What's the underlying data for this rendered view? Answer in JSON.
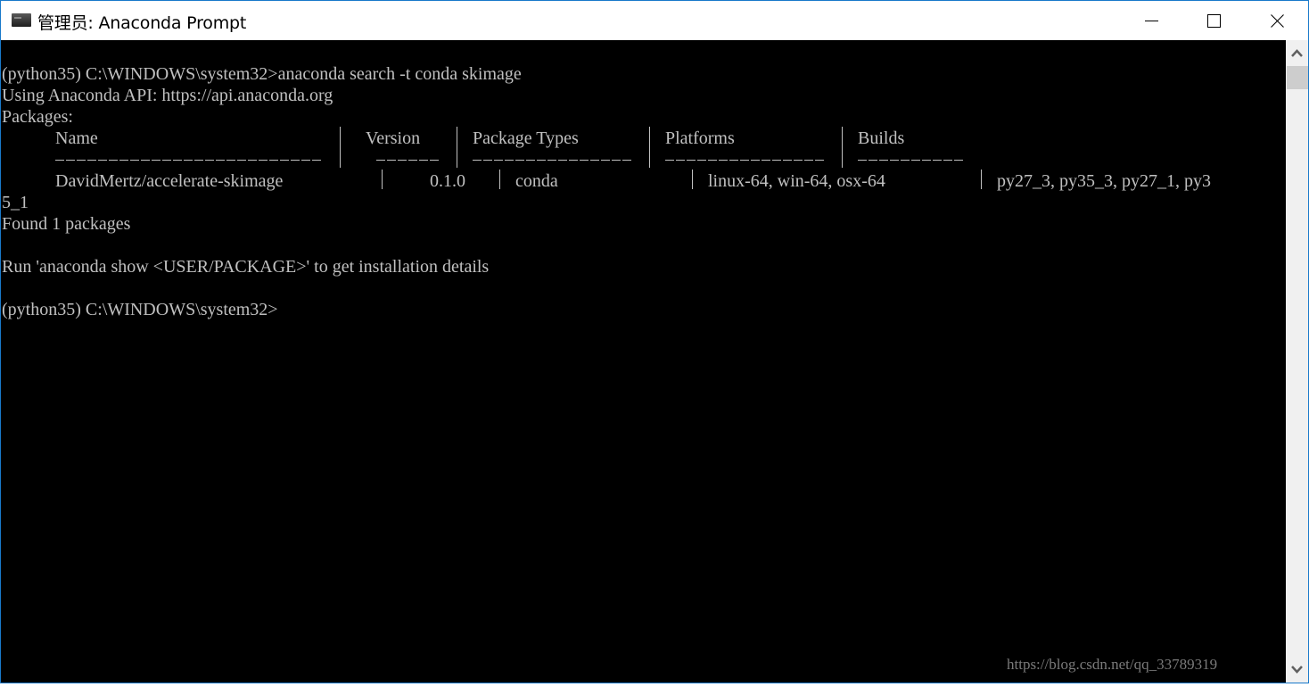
{
  "window": {
    "title": "管理员: Anaconda Prompt",
    "controls": {
      "minimize": "minimize",
      "maximize": "maximize",
      "close": "close"
    }
  },
  "console": {
    "lines": [
      "(python35) C:\\WINDOWS\\system32>anaconda search -t conda skimage",
      "Using Anaconda API: https://api.anaconda.org",
      "Packages:",
      "5_1",
      "Found 1 packages",
      "",
      "Run 'anaconda show <USER/PACKAGE>' to get installation details",
      "",
      "(python35) C:\\WINDOWS\\system32>"
    ],
    "table": {
      "headers": [
        "Name",
        "Version",
        "Package Types",
        "Platforms",
        "Builds"
      ],
      "rows": [
        [
          "DavidMertz/accelerate-skimage",
          "0.1.0",
          "conda",
          "linux-64, win-64, osx-64",
          "py27_3, py35_3, py27_1, py3"
        ]
      ]
    }
  },
  "watermark": "https://blog.csdn.net/qq_33789319"
}
